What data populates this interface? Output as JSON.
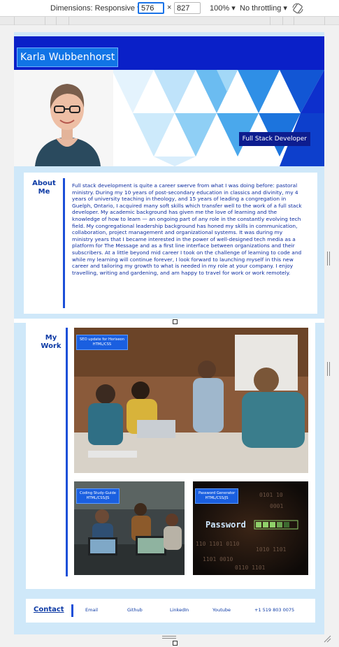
{
  "devtools": {
    "dimensions_label": "Dimensions: Responsive",
    "width_value": "576",
    "times": "×",
    "height_value": "827",
    "zoom_label": "100%",
    "throttle_label": "No throttling"
  },
  "site": {
    "title": "Karla Wubbenhorst",
    "role": "Full Stack Developer"
  },
  "about": {
    "heading_line1": "About",
    "heading_line2": "Me",
    "text": "Full stack development is quite a career swerve from what I was doing before: pastoral ministry. During my 10 years of post-secondary education in classics and divinity, my 4 years of university teaching in theology, and 15 years of leading a congregation in Guelph, Ontario, I acquired many soft skills which transfer well to the work of a full stack developer. My academic background has given me the love of learning and the knowledge of how to learn — an ongoing part of any role in the constantly evolving tech field. My congregational leadership background has honed my skills in communication, collaboration, project management and organizational systems. It was during my ministry years that I became interested in the power of well-designed tech media as a platform for The Message and as a first line interface between organizations and their subscribers. At a little beyond mid career I took on the challenge of learning to code and while my learning will continue forever, I look forward to launching myself in this new career and tailoring my growth to what is needed in my role at your company. I enjoy travelling, writing and gardening, and am happy to travel for work or work remotely."
  },
  "work": {
    "heading_line1": "My",
    "heading_line2": "Work",
    "projects": [
      {
        "title": "SEO update for Horiseon",
        "tech": "HTML/CSS"
      },
      {
        "title": "Coding Study-Guide",
        "tech": "HTML/CSS/JS"
      },
      {
        "title": "Password Generator",
        "tech": "HTML/CSS/JS"
      }
    ],
    "password_word": "Password"
  },
  "footer": {
    "contact": "Contact",
    "links": [
      "Email",
      "Github",
      "LinkedIn",
      "Youtube",
      "+1 519 803 0075"
    ]
  },
  "colors": {
    "accent": "#1b4fd8",
    "text_blue": "#0c2ca0",
    "page_bg": "#cfe8f9"
  }
}
